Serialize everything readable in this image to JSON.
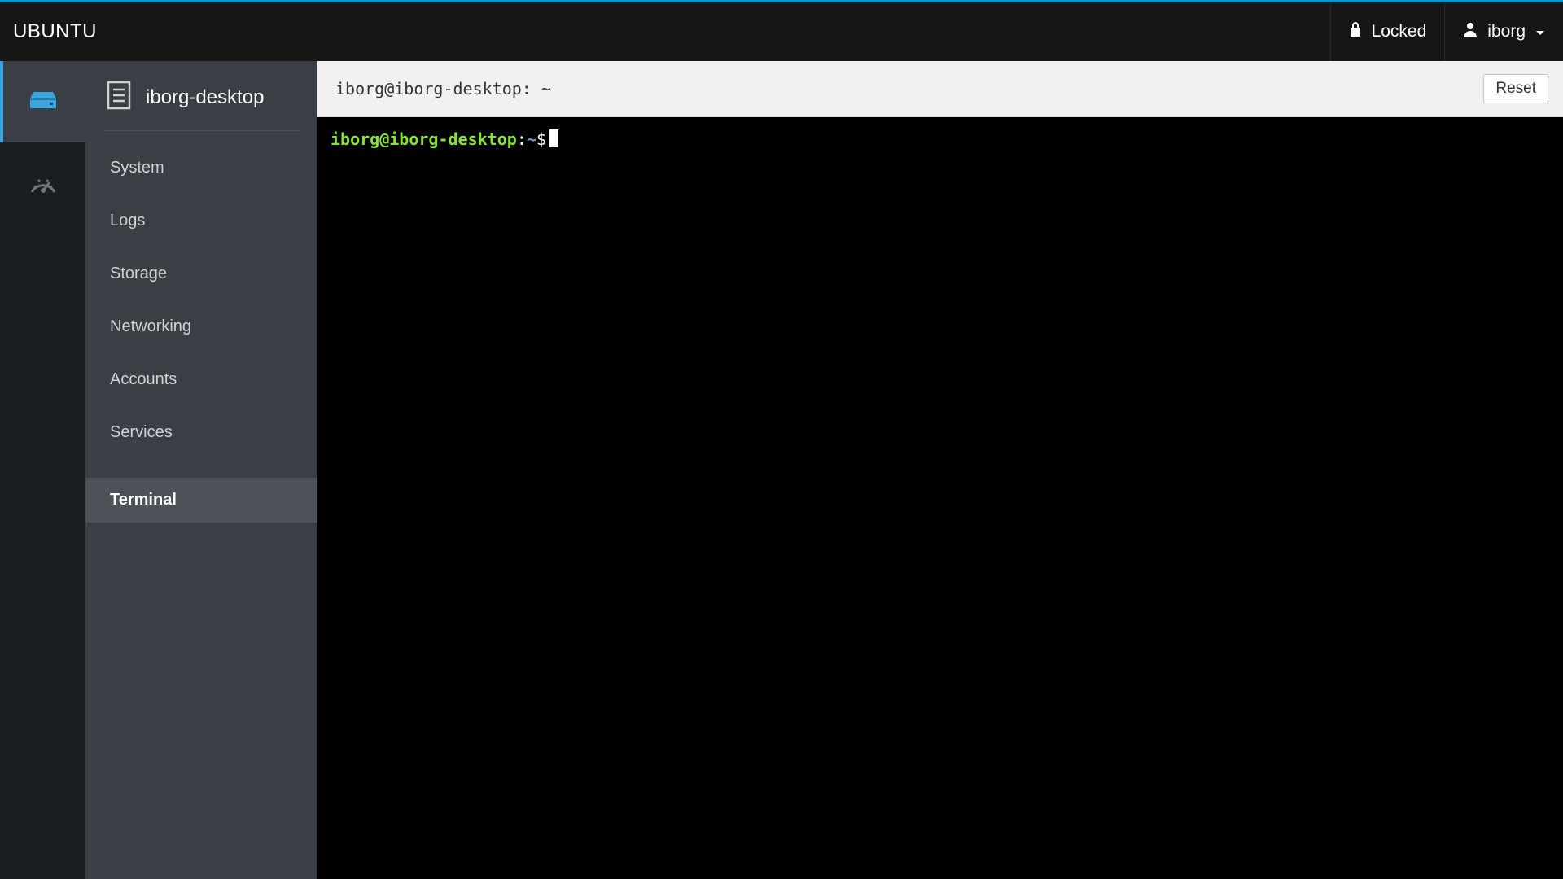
{
  "header": {
    "brand": "UBUNTU",
    "locked_label": "Locked",
    "user_name": "iborg"
  },
  "rail": {
    "items": [
      {
        "key": "host",
        "icon": "server-icon",
        "active": true
      },
      {
        "key": "dashboard",
        "icon": "gauge-icon",
        "active": false
      }
    ]
  },
  "sidebar": {
    "host_label": "iborg-desktop",
    "items": [
      {
        "label": "System",
        "active": false
      },
      {
        "label": "Logs",
        "active": false
      },
      {
        "label": "Storage",
        "active": false
      },
      {
        "label": "Networking",
        "active": false
      },
      {
        "label": "Accounts",
        "active": false
      },
      {
        "label": "Services",
        "active": false
      },
      {
        "label": "Terminal",
        "active": true
      }
    ]
  },
  "toolbar": {
    "title": "iborg@iborg-desktop: ~",
    "reset_label": "Reset"
  },
  "terminal": {
    "prompt_userhost": "iborg@iborg-desktop",
    "prompt_colon": ":",
    "prompt_path": "~",
    "prompt_symbol": "$"
  },
  "colors": {
    "accent": "#0099d3",
    "sidebar_bg": "#393f44",
    "rail_bg": "#1a1d21",
    "term_green": "#8ae234",
    "term_blue": "#729fcf"
  }
}
